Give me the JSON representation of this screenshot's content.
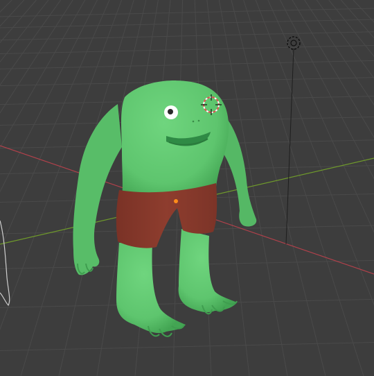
{
  "app": {
    "panel": "3d-viewport",
    "shading_mode": "rendered"
  },
  "scene": {
    "background_color": "#3d3d3d",
    "grid_line_color": "#4a4a4a",
    "axis_x_color": "#b0414b",
    "axis_y_color": "#6f9a2b",
    "objects": [
      {
        "name": "character",
        "parts": [
          "head-body",
          "left-arm",
          "right-arm",
          "shorts",
          "left-leg",
          "right-leg",
          "eye",
          "mouth"
        ],
        "body_color": "#5ec56e",
        "body_shadow_color": "#3f9d4f",
        "shorts_color": "#8b3a2c",
        "eye_color": "#ffffff",
        "pupil_color": "#2a2a2a",
        "mouth_color": "#2f8a45"
      },
      {
        "name": "light-object",
        "icon": "light-icon"
      },
      {
        "name": "camera-object",
        "icon": "camera-outline-icon"
      }
    ],
    "cursor_3d": {
      "icon": "3d-cursor-icon",
      "color": "#e05050"
    },
    "origin_point_color": "#ff8c1a"
  }
}
